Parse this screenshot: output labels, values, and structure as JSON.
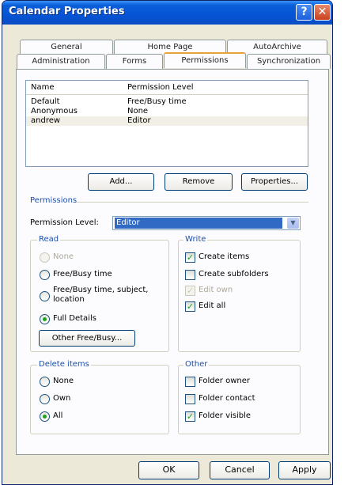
{
  "window": {
    "title": "Calendar Properties",
    "help_glyph": "?",
    "close_glyph": "✕"
  },
  "tabs": {
    "row1": [
      {
        "label": "General"
      },
      {
        "label": "Home Page"
      },
      {
        "label": "AutoArchive"
      }
    ],
    "row2": [
      {
        "label": "Administration"
      },
      {
        "label": "Forms"
      },
      {
        "label": "Permissions"
      },
      {
        "label": "Synchronization"
      }
    ],
    "active": "Permissions"
  },
  "permissions_list": {
    "headers": [
      "Name",
      "Permission Level"
    ],
    "rows": [
      {
        "name": "Default",
        "level": "Free/Busy time"
      },
      {
        "name": "Anonymous",
        "level": "None"
      },
      {
        "name": "andrew",
        "level": "Editor"
      }
    ],
    "selected": "andrew"
  },
  "list_buttons": {
    "add": "Add...",
    "remove": "Remove",
    "properties": "Properties..."
  },
  "permissions_section": {
    "title": "Permissions",
    "level_label": "Permission Level:",
    "level_value": "Editor"
  },
  "read_group": {
    "title": "Read",
    "options": [
      {
        "label": "None",
        "selected": false,
        "enabled": false
      },
      {
        "label": "Free/Busy time",
        "selected": false,
        "enabled": true
      },
      {
        "label": "Free/Busy time, subject,",
        "label2": "location",
        "selected": false,
        "enabled": true
      },
      {
        "label": "Full Details",
        "selected": true,
        "enabled": true
      }
    ],
    "other_button": "Other Free/Busy..."
  },
  "write_group": {
    "title": "Write",
    "options": [
      {
        "label": "Create items",
        "checked": true,
        "enabled": true
      },
      {
        "label": "Create subfolders",
        "checked": false,
        "enabled": true
      },
      {
        "label": "Edit own",
        "checked": true,
        "enabled": false
      },
      {
        "label": "Edit all",
        "checked": true,
        "enabled": true
      }
    ]
  },
  "delete_group": {
    "title": "Delete items",
    "options": [
      {
        "label": "None",
        "selected": false
      },
      {
        "label": "Own",
        "selected": false
      },
      {
        "label": "All",
        "selected": true
      }
    ]
  },
  "other_group": {
    "title": "Other",
    "options": [
      {
        "label": "Folder owner",
        "checked": false
      },
      {
        "label": "Folder contact",
        "checked": false
      },
      {
        "label": "Folder visible",
        "checked": true
      }
    ]
  },
  "dialog_buttons": {
    "ok": "OK",
    "cancel": "Cancel",
    "apply": "Apply"
  },
  "colors": {
    "titlebar": "#0554d6",
    "selection": "#316ac5",
    "group_title": "#1c4ea8",
    "check_mark": "#21a121"
  }
}
